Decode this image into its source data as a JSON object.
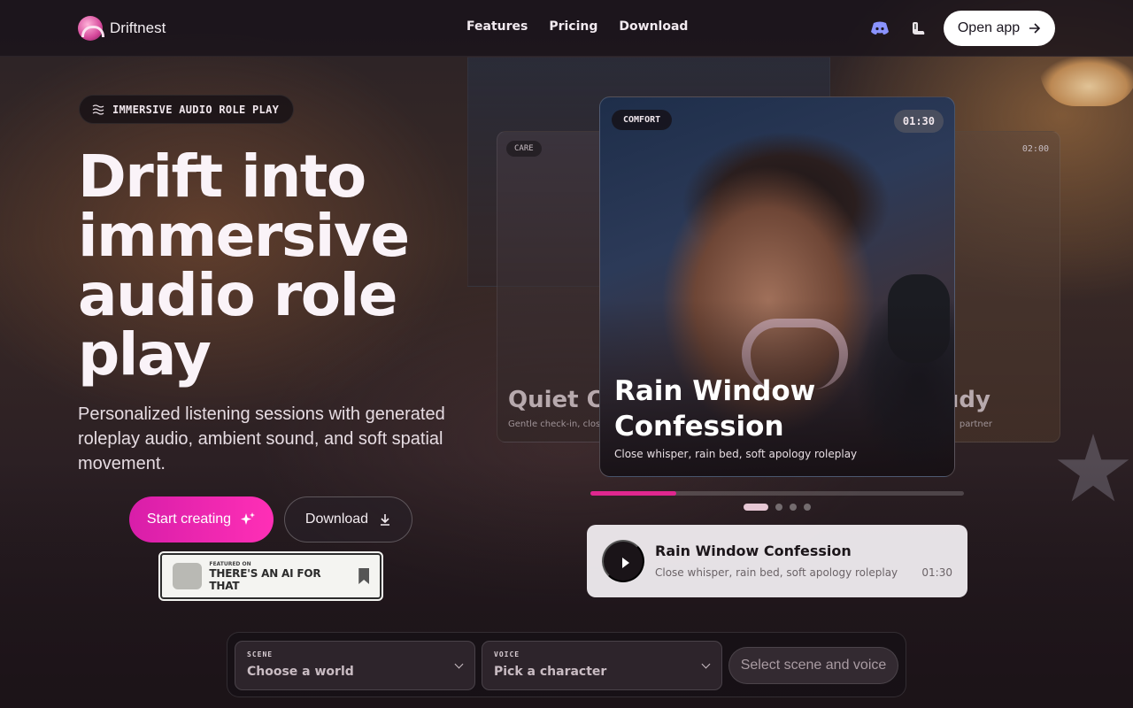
{
  "brand": {
    "name": "Driftnest"
  },
  "nav": {
    "links": [
      "Features",
      "Pricing",
      "Download"
    ],
    "open_app": "Open app"
  },
  "hero": {
    "pill": "IMMERSIVE AUDIO ROLE PLAY",
    "headline": "Drift into immersive audio role play",
    "subtitle": "Personalized listening sessions with generated roleplay audio, ambient sound, and soft spatial movement.",
    "start_button": "Start creating",
    "download_button": "Download",
    "badge": {
      "small": "FEATURED ON",
      "main": "THERE'S AN AI FOR THAT"
    }
  },
  "carousel": {
    "side_left": {
      "tag": "CARE",
      "title": "Quiet Ch",
      "subtitle": "Gentle check-in, clos"
    },
    "side_right": {
      "time": "02:00",
      "title": "udy",
      "subtitle": "partner"
    },
    "main": {
      "tag": "COMFORT",
      "time": "01:30",
      "title": "Rain Window Confession",
      "subtitle": "Close whisper, rain bed, soft apology roleplay"
    },
    "progress": 0.23,
    "active_index": 0,
    "dot_count": 4
  },
  "player": {
    "title": "Rain Window Confession",
    "subtitle": "Close whisper, rain bed, soft apology roleplay",
    "time": "01:30"
  },
  "picker": {
    "scene_label": "SCENE",
    "scene_value": "Choose a world",
    "voice_label": "VOICE",
    "voice_value": "Pick a character",
    "action": "Select scene and voice"
  },
  "colors": {
    "accent": "#e0278f",
    "accent_button": "#ff2fb6"
  }
}
